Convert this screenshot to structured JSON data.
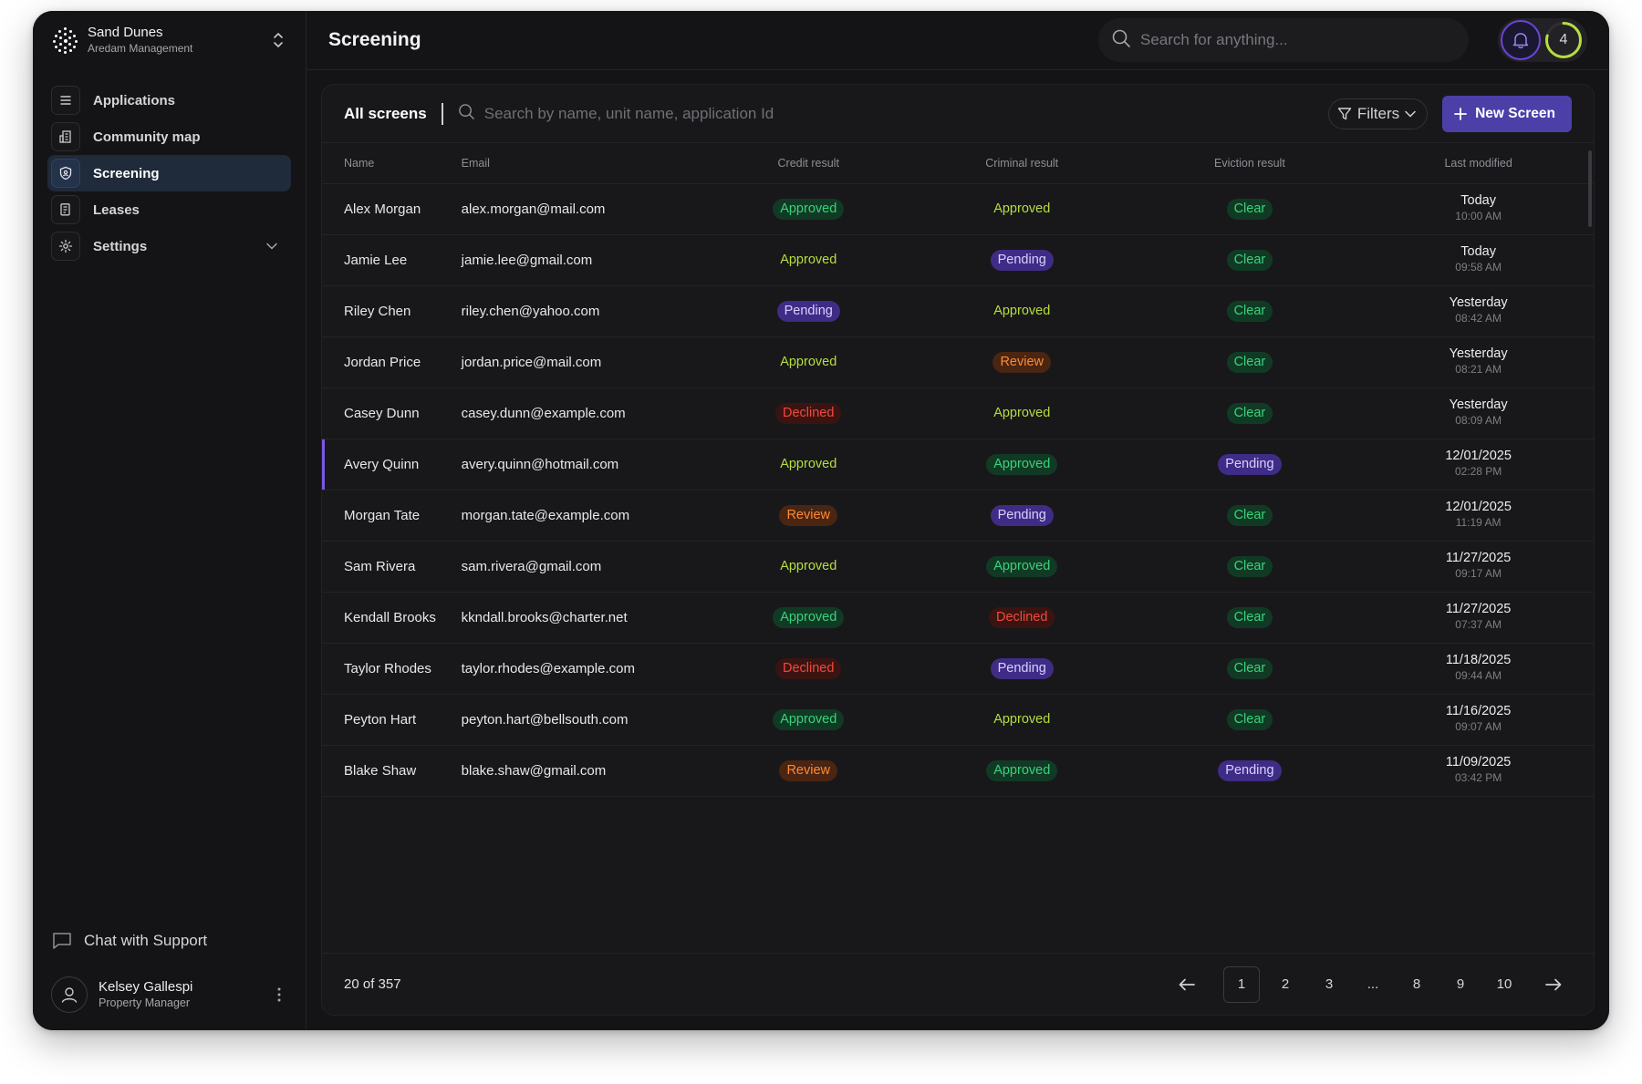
{
  "org": {
    "name": "Sand Dunes",
    "subtitle": "Aredam Management"
  },
  "nav": [
    {
      "label": "Applications",
      "icon": "list-icon"
    },
    {
      "label": "Community map",
      "icon": "building-icon"
    },
    {
      "label": "Screening",
      "icon": "shield-icon",
      "active": true
    },
    {
      "label": "Leases",
      "icon": "document-icon"
    },
    {
      "label": "Settings",
      "icon": "gear-icon"
    }
  ],
  "support": {
    "label": "Chat with Support"
  },
  "user": {
    "name": "Kelsey Gallespi",
    "role": "Property Manager"
  },
  "header": {
    "title": "Screening",
    "search_placeholder": "Search for anything...",
    "notification_count": "4"
  },
  "toolbar": {
    "tab_label": "All screens",
    "search_placeholder": "Search by name, unit name, application Id",
    "filters_label": "Filters",
    "new_label": "New Screen"
  },
  "table": {
    "headers": [
      "Name",
      "Email",
      "Credit result",
      "Criminal result",
      "Eviction result",
      "Last modified"
    ],
    "rows": [
      {
        "name": "Alex Morgan",
        "email": "alex.morgan@mail.com",
        "credit": "Approved",
        "criminal": "Approved",
        "eviction": "Clear",
        "date": "Today",
        "time": "10:00 AM"
      },
      {
        "name": "Jamie Lee",
        "email": "jamie.lee@gmail.com",
        "credit": "Approved",
        "criminal": "Pending",
        "eviction": "Clear",
        "date": "Today",
        "time": "09:58 AM"
      },
      {
        "name": "Riley Chen",
        "email": "riley.chen@yahoo.com",
        "credit": "Pending",
        "criminal": "Approved",
        "eviction": "Clear",
        "date": "Yesterday",
        "time": "08:42 AM"
      },
      {
        "name": "Jordan Price",
        "email": "jordan.price@mail.com",
        "credit": "Approved",
        "criminal": "Review",
        "eviction": "Clear",
        "date": "Yesterday",
        "time": "08:21 AM"
      },
      {
        "name": "Casey Dunn",
        "email": "casey.dunn@example.com",
        "credit": "Declined",
        "criminal": "Approved",
        "eviction": "Clear",
        "date": "Yesterday",
        "time": "08:09 AM"
      },
      {
        "name": "Avery Quinn",
        "email": "avery.quinn@hotmail.com",
        "credit": "Approved",
        "criminal": "Approved",
        "eviction": "Pending",
        "date": "12/01/2025",
        "time": "02:28 PM"
      },
      {
        "name": "Morgan Tate",
        "email": "morgan.tate@example.com",
        "credit": "Review",
        "criminal": "Pending",
        "eviction": "Clear",
        "date": "12/01/2025",
        "time": "11:19 AM"
      },
      {
        "name": "Sam Rivera",
        "email": "sam.rivera@gmail.com",
        "credit": "Approved",
        "criminal": "Approved",
        "eviction": "Clear",
        "date": "11/27/2025",
        "time": "09:17 AM"
      },
      {
        "name": "Kendall Brooks",
        "email": "kkndall.brooks@charter.net",
        "credit": "Approved",
        "criminal": "Declined",
        "eviction": "Clear",
        "date": "11/27/2025",
        "time": "07:37 AM"
      },
      {
        "name": "Taylor Rhodes",
        "email": "taylor.rhodes@example.com",
        "credit": "Declined",
        "criminal": "Pending",
        "eviction": "Clear",
        "date": "11/18/2025",
        "time": "09:44 AM"
      },
      {
        "name": "Peyton Hart",
        "email": "peyton.hart@bellsouth.com",
        "credit": "Approved",
        "criminal": "Approved",
        "eviction": "Clear",
        "date": "11/16/2025",
        "time": "09:07 AM"
      },
      {
        "name": "Blake Shaw",
        "email": "blake.shaw@gmail.com",
        "credit": "Review",
        "criminal": "Approved",
        "eviction": "Pending",
        "date": "11/09/2025",
        "time": "03:42 PM"
      }
    ]
  },
  "pagination": {
    "summary": "20 of 357",
    "pages": [
      "1",
      "2",
      "3",
      "...",
      "8",
      "9",
      "10"
    ],
    "current": "1"
  },
  "colors": {
    "accent": "#4c3fa8",
    "approved": "#3ad27a",
    "pending": "#3f2c86",
    "review": "#ff8a33",
    "declined": "#f04a3c"
  }
}
